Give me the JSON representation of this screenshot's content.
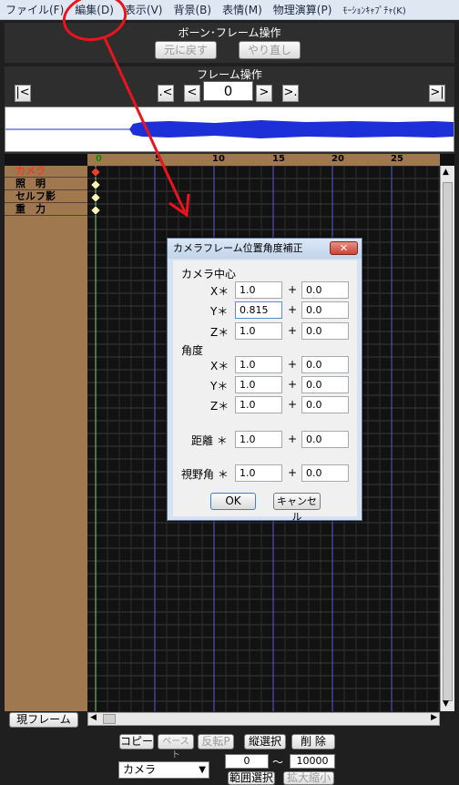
{
  "menu": [
    "ファイル(F)",
    "編集(D)",
    "表示(V)",
    "背景(B)",
    "表情(M)",
    "物理演算(P)",
    "ﾓｰｼｮﾝｷｬﾌﾟﾁｬ(K)"
  ],
  "bone_panel": {
    "title": "ボーン･フレーム操作",
    "undo": "元に戻す",
    "redo": "やり直し"
  },
  "frame_panel": {
    "title": "フレーム操作",
    "frame_value": "0",
    "nav": {
      "first": "|<",
      "prev_key": ".<",
      "prev": "<",
      "next": ">",
      "next_key": ">.",
      "last": ">|"
    }
  },
  "ruler_ticks": [
    "0",
    "5",
    "10",
    "15",
    "20",
    "25"
  ],
  "tracks": [
    "カメラ",
    "照　明",
    "セルフ影",
    "重　力"
  ],
  "dialog": {
    "title": "カメラフレーム位置角度補正",
    "close": "✕",
    "section_center": "カメラ中心",
    "section_angle": "角度",
    "center": [
      {
        "label": "X＊",
        "mul": "1.0",
        "add": "0.0"
      },
      {
        "label": "Y＊",
        "mul": "0.815",
        "add": "0.0"
      },
      {
        "label": "Z＊",
        "mul": "1.0",
        "add": "0.0"
      }
    ],
    "angle": [
      {
        "label": "X＊",
        "mul": "1.0",
        "add": "0.0"
      },
      {
        "label": "Y＊",
        "mul": "1.0",
        "add": "0.0"
      },
      {
        "label": "Z＊",
        "mul": "1.0",
        "add": "0.0"
      }
    ],
    "distance": {
      "label": "距離 ＊",
      "mul": "1.0",
      "add": "0.0"
    },
    "fov": {
      "label": "視野角 ＊",
      "mul": "1.0",
      "add": "0.0"
    },
    "plus": "+",
    "ok": "OK",
    "cancel": "キャンセル"
  },
  "bottom": {
    "current_frame": "現フレーム",
    "copy": "コピー",
    "paste": "ペースト",
    "reverse_paste": "反転P",
    "col_select": "縦選択",
    "delete": "削 除",
    "range_select": "範囲選択",
    "zoom": "拡大縮小",
    "track_select": "カメラ",
    "range_from": "0",
    "tilde": "～",
    "range_to": "10000"
  },
  "colors": {
    "accent_red": "#e8402a",
    "annotation": "#e8141e",
    "timeline_bg": "#a07850"
  }
}
